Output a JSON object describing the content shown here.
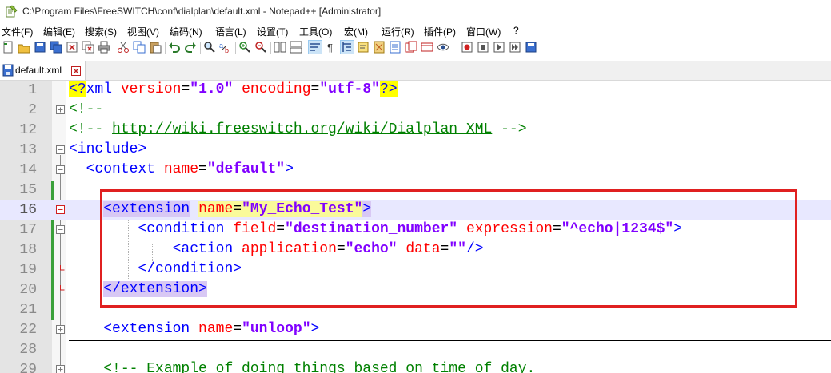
{
  "window": {
    "title": "C:\\Program Files\\FreeSWITCH\\conf\\dialplan\\default.xml - Notepad++ [Administrator]"
  },
  "menu": [
    "文件(F)",
    "编辑(E)",
    "搜索(S)",
    "视图(V)",
    "编码(N)",
    "语言(L)",
    "设置(T)",
    "工具(O)",
    "宏(M)",
    "运行(R)",
    "插件(P)",
    "窗口(W)",
    "?"
  ],
  "tabs": [
    {
      "label": "default.xml",
      "active": true
    }
  ],
  "editor": {
    "lines": [
      {
        "num": "1",
        "segments": [
          [
            "hl-y tag",
            "<?"
          ],
          [
            "tag",
            "xml "
          ],
          [
            "attr",
            "version"
          ],
          [
            "punct",
            "="
          ],
          [
            "val",
            "\"1.0\""
          ],
          [
            "punct",
            " "
          ],
          [
            "attr",
            "encoding"
          ],
          [
            "punct",
            "="
          ],
          [
            "val",
            "\"utf-8\""
          ],
          [
            "hl-y tag",
            "?>"
          ]
        ]
      },
      {
        "num": "2",
        "segments": [
          [
            "comment",
            "<!--"
          ]
        ]
      },
      {
        "num": "12",
        "segments": [
          [
            "comment",
            "<!-- "
          ],
          [
            "link",
            "http://wiki.freeswitch.org/wiki/Dialplan_XML"
          ],
          [
            "comment",
            " -->"
          ]
        ]
      },
      {
        "num": "13",
        "segments": [
          [
            "tag",
            "<include>"
          ]
        ]
      },
      {
        "num": "14",
        "segments": [
          [
            "punct",
            "  "
          ],
          [
            "tag",
            "<context "
          ],
          [
            "attr",
            "name"
          ],
          [
            "punct",
            "="
          ],
          [
            "val",
            "\"default\""
          ],
          [
            "tag",
            ">"
          ]
        ]
      },
      {
        "num": "15",
        "segments": []
      },
      {
        "num": "16",
        "segments": [
          [
            "punct",
            "    "
          ],
          [
            "hl-ext tag",
            "<extension"
          ],
          [
            "punct",
            " "
          ],
          [
            "hl-y-soft attr",
            "name"
          ],
          [
            "hl-y-soft punct",
            "="
          ],
          [
            "hl-y-soft val",
            "\"My_Echo_Test\""
          ],
          [
            "hl-ext tag",
            ">"
          ]
        ]
      },
      {
        "num": "17",
        "segments": [
          [
            "punct",
            "        "
          ],
          [
            "tag",
            "<condition "
          ],
          [
            "attr",
            "field"
          ],
          [
            "punct",
            "="
          ],
          [
            "val",
            "\"destination_number\""
          ],
          [
            "punct",
            " "
          ],
          [
            "attr",
            "expression"
          ],
          [
            "punct",
            "="
          ],
          [
            "val",
            "\"^echo|1234$\""
          ],
          [
            "tag",
            ">"
          ]
        ]
      },
      {
        "num": "18",
        "segments": [
          [
            "punct",
            "            "
          ],
          [
            "tag",
            "<action "
          ],
          [
            "attr",
            "application"
          ],
          [
            "punct",
            "="
          ],
          [
            "val",
            "\"echo\""
          ],
          [
            "punct",
            " "
          ],
          [
            "attr",
            "data"
          ],
          [
            "punct",
            "="
          ],
          [
            "val",
            "\"\""
          ],
          [
            "tag",
            "/>"
          ]
        ]
      },
      {
        "num": "19",
        "segments": [
          [
            "punct",
            "        "
          ],
          [
            "tag",
            "</condition>"
          ]
        ]
      },
      {
        "num": "20",
        "segments": [
          [
            "punct",
            "    "
          ],
          [
            "hl-ext tag",
            "</extension>"
          ]
        ]
      },
      {
        "num": "21",
        "segments": []
      },
      {
        "num": "22",
        "segments": [
          [
            "punct",
            "    "
          ],
          [
            "tag",
            "<extension "
          ],
          [
            "attr",
            "name"
          ],
          [
            "punct",
            "="
          ],
          [
            "val",
            "\"unloop\""
          ],
          [
            "tag",
            ">"
          ]
        ]
      },
      {
        "num": "28",
        "segments": []
      },
      {
        "num": "29",
        "segments": [
          [
            "punct",
            "    "
          ],
          [
            "comment",
            "<!-- Example of doing things based on time of day."
          ]
        ]
      }
    ]
  },
  "icons": {
    "app": "notepad-plus-plus-icon",
    "file_tab": "saved-file-icon",
    "tab_close": "close-icon"
  },
  "colors": {
    "tag": "#0000ff",
    "attribute": "#ff0000",
    "value": "#8000ff",
    "comment": "#008000",
    "current_line": "#e8e8ff",
    "highlight_box": "#e02020",
    "changed_lines": "#3aa03a"
  }
}
